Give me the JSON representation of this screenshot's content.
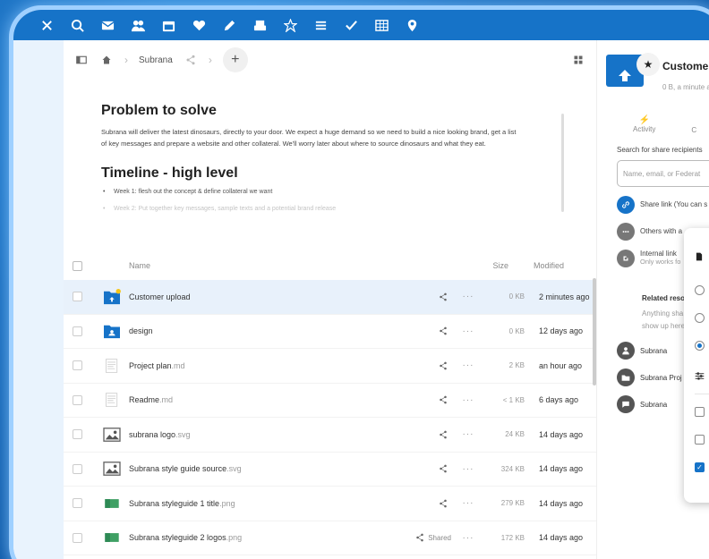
{
  "topbar": {
    "apps": [
      "menu-icon",
      "search-icon",
      "mail-icon",
      "contacts-icon",
      "calendar-icon",
      "heart-icon",
      "pencil-icon",
      "inbox-icon",
      "star-icon",
      "list-icon",
      "check-icon",
      "table-icon",
      "map-pin-icon"
    ]
  },
  "breadcrumb": {
    "folder": "Subrana"
  },
  "readme": {
    "heading1": "Problem to solve",
    "paragraph": "Subrana will deliver the latest dinosaurs, directly to your door. We expect a huge demand so we need to build a nice looking brand, get a list of key messages and prepare a website and other collateral. We'll worry later about where to source dinosaurs and what they eat.",
    "heading2": "Timeline - high level",
    "bullets": [
      "Week 1: flesh out the concept & define collateral we want",
      "Week 2: Put together key messages, sample texts and a potential brand release"
    ]
  },
  "filelist": {
    "columns": {
      "name": "Name",
      "size": "Size",
      "modified": "Modified"
    },
    "rows": [
      {
        "name": "Customer upload",
        "ext": "",
        "icon": "folder-upload-icon",
        "size": "0 KB",
        "modified": "2 minutes ago",
        "share": "",
        "selected": true
      },
      {
        "name": "design",
        "ext": "",
        "icon": "folder-shared-icon",
        "size": "0 KB",
        "modified": "12 days ago",
        "share": "",
        "selected": false
      },
      {
        "name": "Project plan",
        "ext": ".md",
        "icon": "document-icon",
        "size": "2 KB",
        "modified": "an hour ago",
        "share": "",
        "selected": false
      },
      {
        "name": "Readme",
        "ext": ".md",
        "icon": "document-icon",
        "size": "< 1 KB",
        "modified": "6 days ago",
        "share": "",
        "selected": false
      },
      {
        "name": "subrana logo",
        "ext": ".svg",
        "icon": "image-icon",
        "size": "24 KB",
        "modified": "14 days ago",
        "share": "",
        "selected": false
      },
      {
        "name": "Subrana style guide source",
        "ext": ".svg",
        "icon": "image-icon",
        "size": "324 KB",
        "modified": "14 days ago",
        "share": "",
        "selected": false
      },
      {
        "name": "Subrana styleguide 1 title",
        "ext": ".png",
        "icon": "png-thumbnail-icon",
        "size": "279 KB",
        "modified": "14 days ago",
        "share": "",
        "selected": false
      },
      {
        "name": "Subrana styleguide 2 logos",
        "ext": ".png",
        "icon": "png-thumbnail-icon",
        "size": "172 KB",
        "modified": "14 days ago",
        "share": "Shared",
        "selected": false
      }
    ]
  },
  "sidebar": {
    "title": "Customer u",
    "subtitle": "0 B, a minute a",
    "tabs": [
      "Activity",
      "C"
    ],
    "search_label": "Search for share recipients",
    "search_placeholder": "Name, email, or Federat",
    "share_link": "Share link (You can s",
    "others": "Others with a",
    "internal_link": "Internal link",
    "internal_sub": "Only works fo",
    "related_heading": "Related reso",
    "related_text_1": "Anything sha",
    "related_text_2": "show up here",
    "resources": [
      "Subrana",
      "Subrana Proj",
      "Subrana"
    ]
  },
  "colors": {
    "brand": "#1673c8",
    "selected_row": "#e8f1fb",
    "frame_glow": "#9fd0ff"
  }
}
